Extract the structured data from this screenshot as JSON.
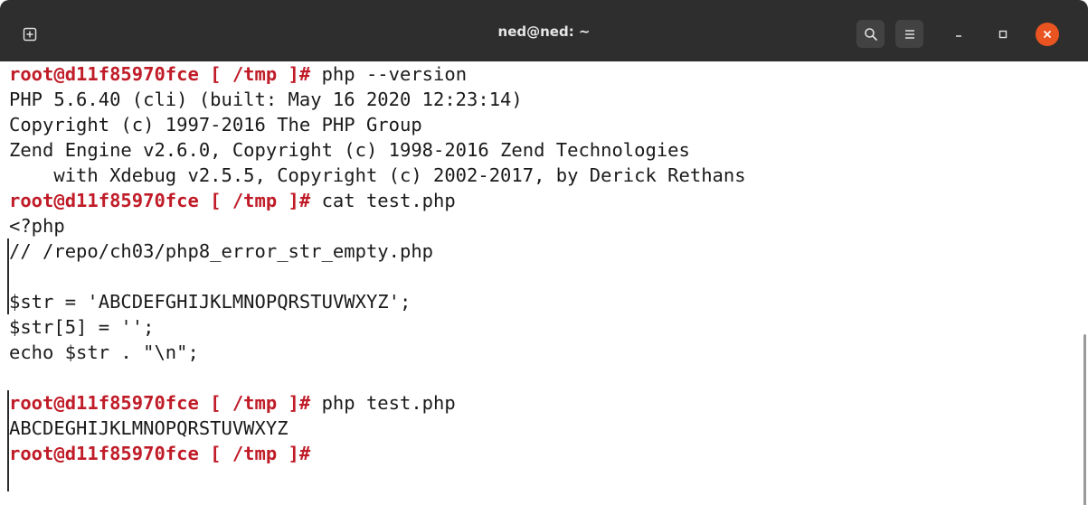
{
  "window": {
    "title": "ned@ned: ~"
  },
  "icons": {
    "new_tab": "new-tab-icon",
    "search": "search-icon",
    "menu": "hamburger-menu-icon",
    "minimize": "minimize-icon",
    "maximize": "maximize-icon",
    "close": "close-icon"
  },
  "colors": {
    "titlebar": "#2e2e2e",
    "prompt": "#c01c28",
    "close_button": "#e95420",
    "terminal_bg": "#ffffff",
    "text": "#1a1a1a"
  },
  "terminal": {
    "lines": [
      {
        "prompt": "root@d11f85970fce [ /tmp ]#",
        "text": " php --version"
      },
      {
        "prompt": "",
        "text": "PHP 5.6.40 (cli) (built: May 16 2020 12:23:14)"
      },
      {
        "prompt": "",
        "text": "Copyright (c) 1997-2016 The PHP Group"
      },
      {
        "prompt": "",
        "text": "Zend Engine v2.6.0, Copyright (c) 1998-2016 Zend Technologies"
      },
      {
        "prompt": "",
        "text": "    with Xdebug v2.5.5, Copyright (c) 2002-2017, by Derick Rethans"
      },
      {
        "prompt": "root@d11f85970fce [ /tmp ]#",
        "text": " cat test.php"
      },
      {
        "prompt": "",
        "text": "<?php"
      },
      {
        "prompt": "",
        "text": "// /repo/ch03/php8_error_str_empty.php"
      },
      {
        "prompt": "",
        "text": ""
      },
      {
        "prompt": "",
        "text": "$str = 'ABCDEFGHIJKLMNOPQRSTUVWXYZ';"
      },
      {
        "prompt": "",
        "text": "$str[5] = '';"
      },
      {
        "prompt": "",
        "text": "echo $str . \"\\n\";"
      },
      {
        "prompt": "",
        "text": ""
      },
      {
        "prompt": "root@d11f85970fce [ /tmp ]#",
        "text": " php test.php"
      },
      {
        "prompt": "",
        "text": "ABCDEGHIJKLMNOPQRSTUVWXYZ"
      },
      {
        "prompt": "root@d11f85970fce [ /tmp ]#",
        "text": ""
      }
    ]
  }
}
